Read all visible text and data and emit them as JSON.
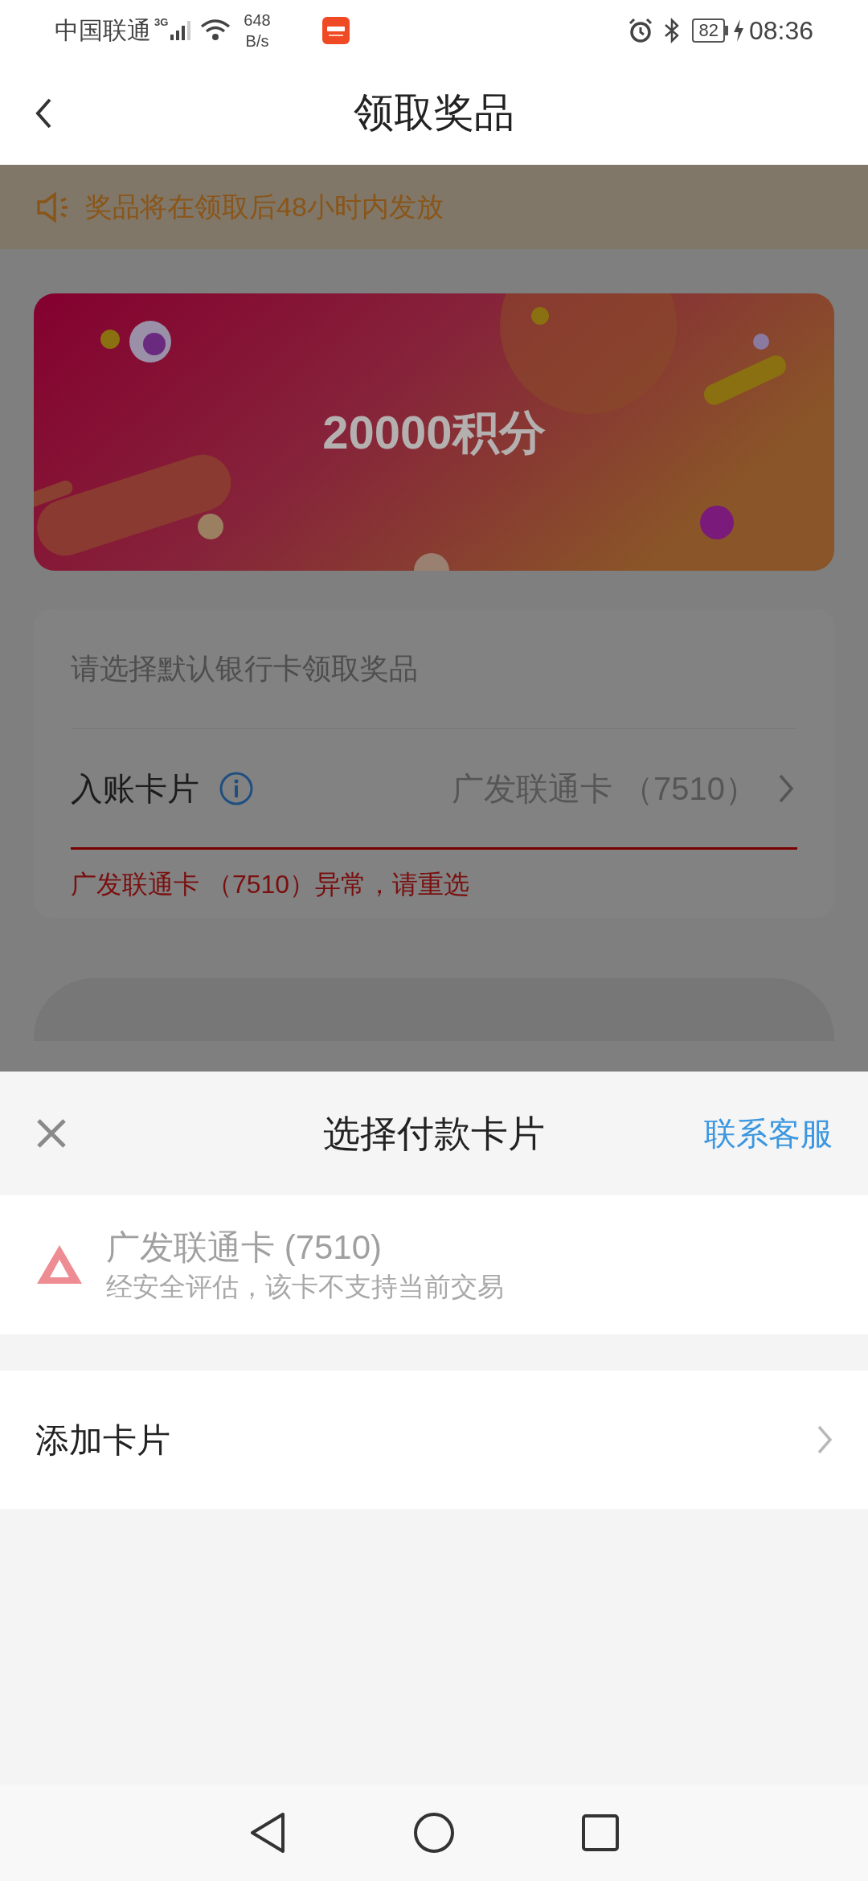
{
  "status_bar": {
    "carrier": "中国联通",
    "network": "3G",
    "speed": "648",
    "speed_unit": "B/s",
    "battery": "82",
    "time": "08:36"
  },
  "header": {
    "title": "领取奖品"
  },
  "notice": {
    "text": "奖品将在领取后48小时内发放"
  },
  "prize": {
    "text": "20000积分"
  },
  "form": {
    "hint": "请选择默认银行卡领取奖品",
    "label": "入账卡片",
    "value": "广发联通卡 （7510）",
    "error": "广发联通卡 （7510）异常，请重选"
  },
  "sheet": {
    "title": "选择付款卡片",
    "contact": "联系客服",
    "cards": [
      {
        "name": "广发联通卡 (7510)",
        "note": "经安全评估，该卡不支持当前交易",
        "disabled": true
      }
    ],
    "add_card": "添加卡片"
  }
}
